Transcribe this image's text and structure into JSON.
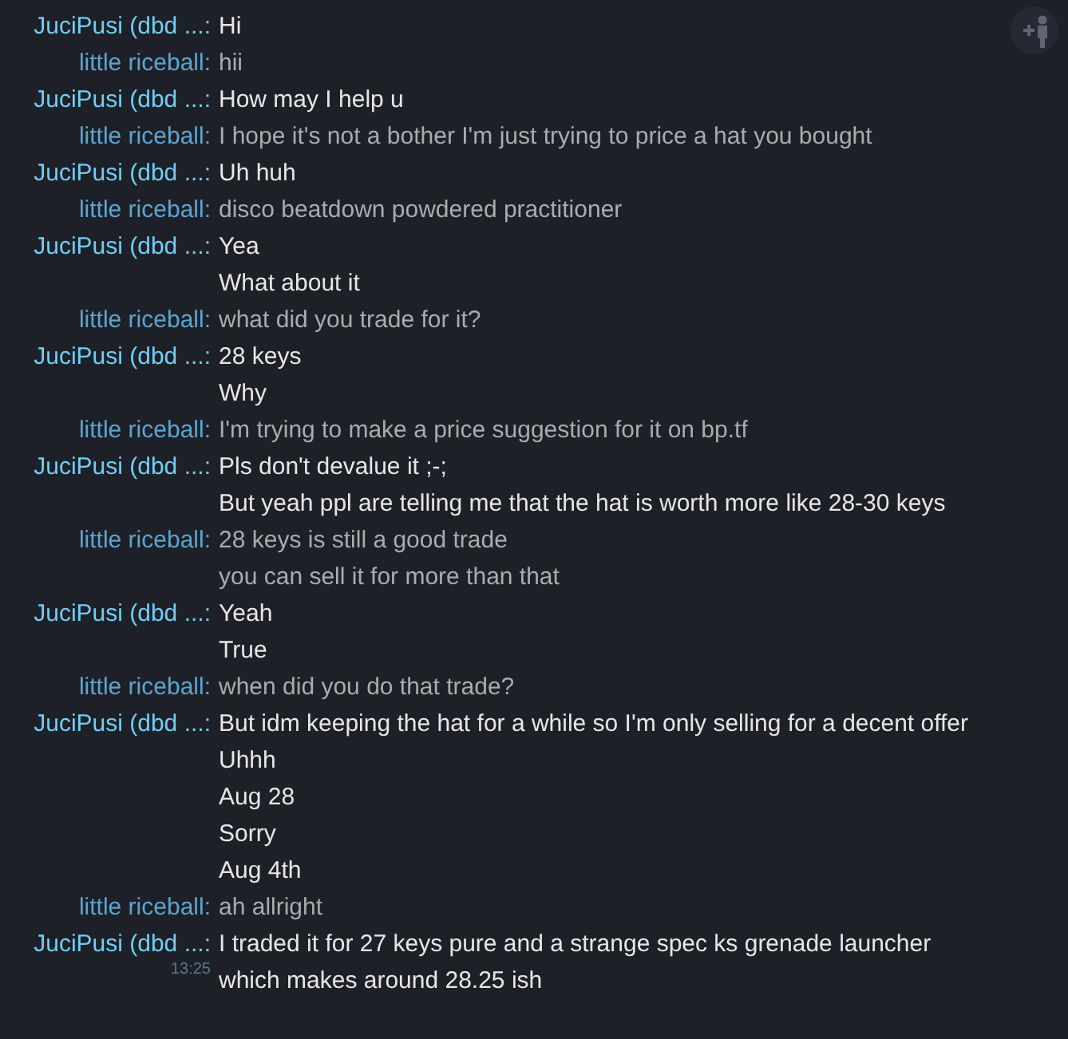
{
  "groups": [
    {
      "sender": "JuciPusi (dbd ...:",
      "kind": "partner",
      "lines": [
        "Hi"
      ]
    },
    {
      "sender": "little riceball:",
      "kind": "self",
      "lines": [
        "hii"
      ]
    },
    {
      "sender": "JuciPusi (dbd ...:",
      "kind": "partner",
      "lines": [
        "How may I help u"
      ]
    },
    {
      "sender": "little riceball:",
      "kind": "self",
      "lines": [
        "I hope it's not a bother I'm just trying to price a hat you bought"
      ]
    },
    {
      "sender": "JuciPusi (dbd ...:",
      "kind": "partner",
      "lines": [
        "Uh huh"
      ]
    },
    {
      "sender": "little riceball:",
      "kind": "self",
      "lines": [
        "disco beatdown powdered practitioner"
      ]
    },
    {
      "sender": "JuciPusi (dbd ...:",
      "kind": "partner",
      "lines": [
        "Yea",
        "What about it"
      ]
    },
    {
      "sender": "little riceball:",
      "kind": "self",
      "lines": [
        "what did you trade for it?"
      ]
    },
    {
      "sender": "JuciPusi (dbd ...:",
      "kind": "partner",
      "lines": [
        "28 keys",
        "Why"
      ]
    },
    {
      "sender": "little riceball:",
      "kind": "self",
      "lines": [
        "I'm trying to make a price suggestion for it on bp.tf"
      ]
    },
    {
      "sender": "JuciPusi (dbd ...:",
      "kind": "partner",
      "lines": [
        "Pls don't devalue it ;-;",
        "But yeah ppl are telling me that the hat is worth more like 28-30 keys"
      ]
    },
    {
      "sender": "little riceball:",
      "kind": "self",
      "lines": [
        "28 keys is still a good trade",
        "you can sell it for more than that"
      ]
    },
    {
      "sender": "JuciPusi (dbd ...:",
      "kind": "partner",
      "lines": [
        "Yeah",
        "True"
      ]
    },
    {
      "sender": "little riceball:",
      "kind": "self",
      "lines": [
        "when did you do that trade?"
      ]
    },
    {
      "sender": "JuciPusi (dbd ...:",
      "kind": "partner",
      "lines": [
        "But idm keeping the hat for a while so I'm only selling for a decent offer",
        "Uhhh",
        "Aug 28",
        "Sorry",
        "Aug 4th"
      ]
    },
    {
      "sender": "little riceball:",
      "kind": "self",
      "lines": [
        "ah allright"
      ]
    },
    {
      "sender": "JuciPusi (dbd ...:",
      "kind": "partner",
      "time": "13:25",
      "lines": [
        "I traded it for 27 keys pure and a strange spec ks grenade launcher",
        "which makes around 28.25 ish"
      ]
    }
  ]
}
